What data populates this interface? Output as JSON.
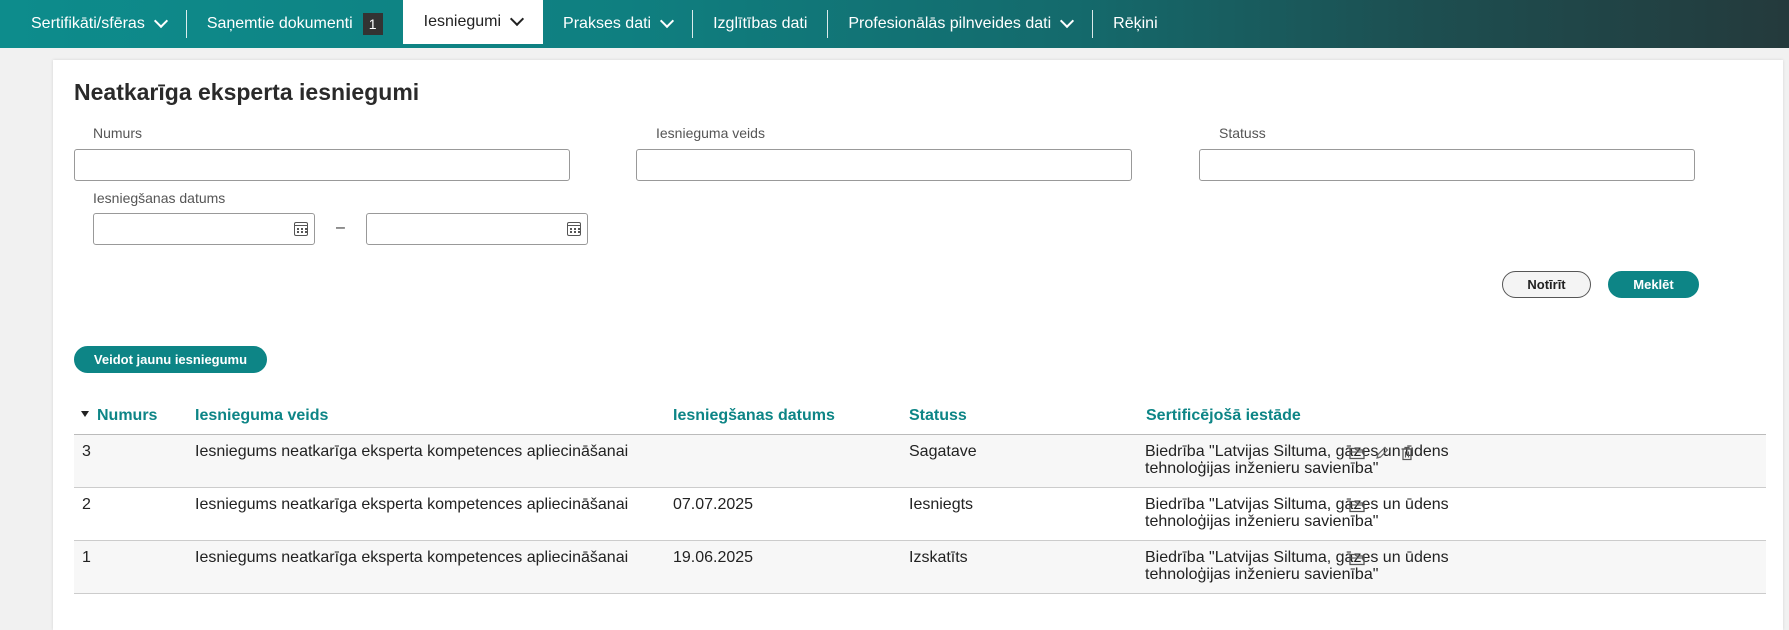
{
  "nav": {
    "items": [
      {
        "label": "Sertifikāti/sfēras",
        "has_dropdown": true
      },
      {
        "label": "Saņemtie dokumenti",
        "badge": "1"
      },
      {
        "label": "Iesniegumi",
        "has_dropdown": true,
        "active": true
      },
      {
        "label": "Prakses dati",
        "has_dropdown": true
      },
      {
        "label": "Izglītības dati"
      },
      {
        "label": "Profesionālās pilnveides dati",
        "has_dropdown": true
      },
      {
        "label": "Rēķini"
      }
    ]
  },
  "page": {
    "title": "Neatkarīga eksperta iesniegumi"
  },
  "filters": {
    "number_label": "Numurs",
    "number_value": "",
    "type_label": "Iesnieguma veids",
    "type_value": "",
    "status_label": "Statuss",
    "status_value": "",
    "date_label": "Iesniegšanas datums",
    "date_from": "",
    "date_to": "",
    "date_separator": "–",
    "clear_button": "Notīrīt",
    "search_button": "Meklēt"
  },
  "create_button": "Veidot jaunu iesniegumu",
  "table": {
    "columns": [
      "Numurs",
      "Iesnieguma veids",
      "Iesniegšanas datums",
      "Statuss",
      "Sertificējošā iestāde"
    ],
    "sort_column": "Numurs",
    "rows": [
      {
        "number": "3",
        "type": "Iesniegums neatkarīga eksperta kompetences apliecināšanai",
        "date": "",
        "status": "Sagatave",
        "institution_line1": "Biedrība \"Latvijas Siltuma, gāzes un ūdens",
        "institution_line2": "tehnoloģijas inženieru savienība\"",
        "actions": [
          "folder-icon",
          "edit-icon",
          "trash-icon"
        ]
      },
      {
        "number": "2",
        "type": "Iesniegums neatkarīga eksperta kompetences apliecināšanai",
        "date": "07.07.2025",
        "status": "Iesniegts",
        "institution_line1": "Biedrība \"Latvijas Siltuma, gāzes un ūdens",
        "institution_line2": "tehnoloģijas inženieru savienība\"",
        "actions": [
          "folder-icon"
        ]
      },
      {
        "number": "1",
        "type": "Iesniegums neatkarīga eksperta kompetences apliecināšanai",
        "date": "19.06.2025",
        "status": "Izskatīts",
        "institution_line1": "Biedrība \"Latvijas Siltuma, gāzes un ūdens",
        "institution_line2": "tehnoloģijas inženieru savienība\"",
        "actions": [
          "folder-icon"
        ]
      }
    ]
  },
  "colors": {
    "accent": "#0d8586",
    "nav_start": "#0d8c8c",
    "nav_end": "#243a3c"
  }
}
